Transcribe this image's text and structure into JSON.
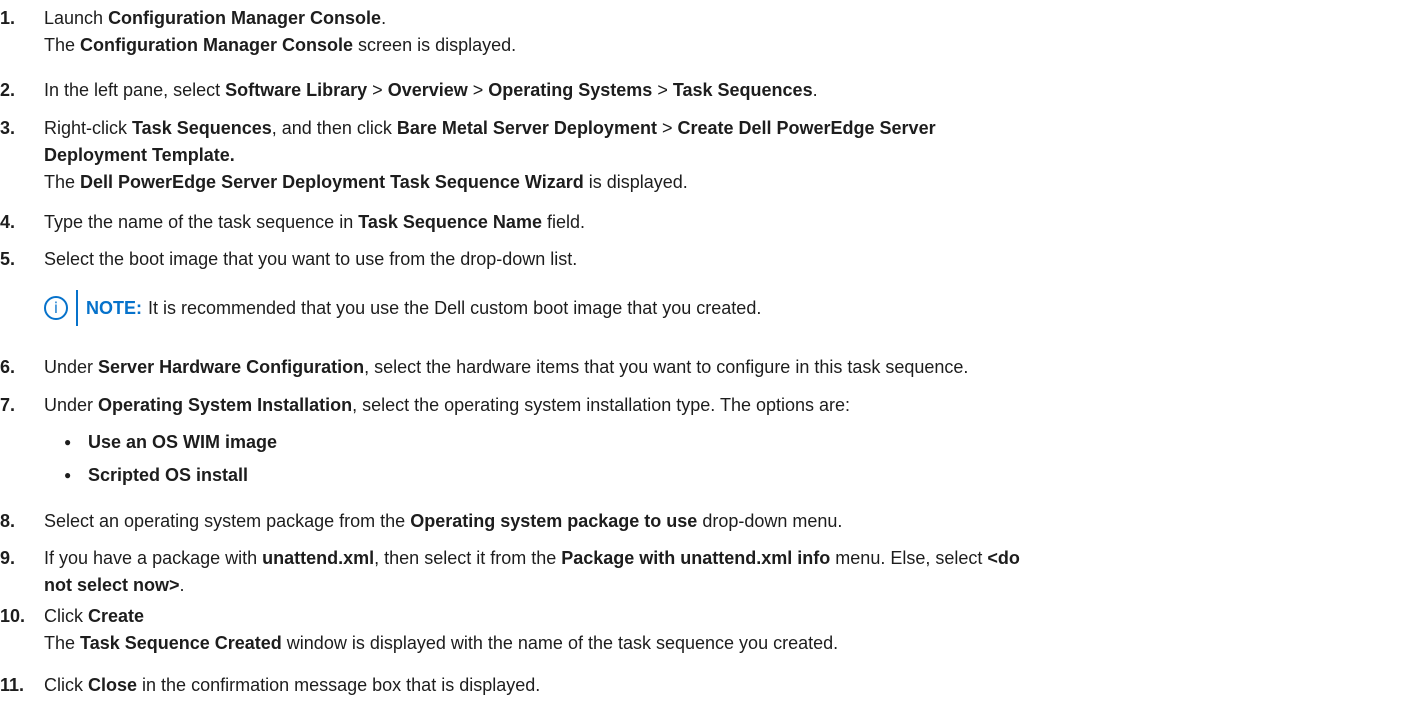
{
  "steps": [
    {
      "num": "1.",
      "parts": [
        [
          "Launch ",
          false
        ],
        [
          "Configuration Manager Console",
          true
        ],
        [
          ".",
          false
        ]
      ],
      "line2": [
        [
          "The ",
          false
        ],
        [
          "Configuration Manager Console",
          true
        ],
        [
          " screen is displayed.",
          false
        ]
      ]
    },
    {
      "num": "2.",
      "parts": [
        [
          "In the left pane, select ",
          false
        ],
        [
          "Software Library",
          true
        ],
        [
          " > ",
          false
        ],
        [
          "Overview",
          true
        ],
        [
          " > ",
          false
        ],
        [
          "Operating Systems",
          true
        ],
        [
          " > ",
          false
        ],
        [
          "Task Sequences",
          true
        ],
        [
          ".",
          false
        ]
      ]
    },
    {
      "num": "3.",
      "parts": [
        [
          "Right-click ",
          false
        ],
        [
          "Task Sequences",
          true
        ],
        [
          ", and then click ",
          false
        ],
        [
          "Bare Metal Server Deployment",
          true
        ],
        [
          " > ",
          false
        ],
        [
          "Create Dell PowerEdge Server",
          true
        ]
      ],
      "line2": [
        [
          "Deployment Template.",
          true
        ]
      ],
      "line3": [
        [
          "The ",
          false
        ],
        [
          "Dell PowerEdge Server Deployment Task Sequence Wizard",
          true
        ],
        [
          " is displayed.",
          false
        ]
      ]
    },
    {
      "num": "4.",
      "parts": [
        [
          "Type the name of the task sequence in ",
          false
        ],
        [
          "Task Sequence Name",
          true
        ],
        [
          " field.",
          false
        ]
      ]
    },
    {
      "num": "5.",
      "parts": [
        [
          "Select the boot image that you want to use from the drop-down list.",
          false
        ]
      ]
    },
    {
      "num": "6.",
      "parts": [
        [
          "Under ",
          false
        ],
        [
          "Server Hardware Configuration",
          true
        ],
        [
          ", select the hardware items that you want to configure in this task sequence.",
          false
        ]
      ]
    },
    {
      "num": "7.",
      "parts": [
        [
          "Under ",
          false
        ],
        [
          "Operating System Installation",
          true
        ],
        [
          ", select the operating system installation type. The options are:",
          false
        ]
      ]
    },
    {
      "num": "8.",
      "parts": [
        [
          "Select an operating system package from the ",
          false
        ],
        [
          "Operating system package to use",
          true
        ],
        [
          " drop-down menu.",
          false
        ]
      ]
    },
    {
      "num": "9.",
      "parts": [
        [
          "If you have a package with ",
          false
        ],
        [
          "unattend.xml",
          true
        ],
        [
          ", then select it from the ",
          false
        ],
        [
          "Package with unattend.xml info",
          true
        ],
        [
          " menu. Else, select ",
          false
        ],
        [
          "<do",
          true
        ]
      ],
      "line2": [
        [
          "not select now>",
          true
        ],
        [
          ".",
          false
        ]
      ]
    },
    {
      "num": "10.",
      "parts": [
        [
          "Click ",
          false
        ],
        [
          "Create",
          true
        ]
      ],
      "line2": [
        [
          "The ",
          false
        ],
        [
          "Task Sequence Created",
          true
        ],
        [
          " window is displayed with the name of the task sequence you created.",
          false
        ]
      ]
    },
    {
      "num": "11.",
      "parts": [
        [
          "Click ",
          false
        ],
        [
          "Close",
          true
        ],
        [
          " in the confirmation message box that is displayed.",
          false
        ]
      ]
    }
  ],
  "note": {
    "icon": "info-icon",
    "label": "NOTE:",
    "text": "It is recommended that you use the Dell custom boot image that you created."
  },
  "bullets": [
    "Use an OS WIM image",
    "Scripted OS install"
  ],
  "colors": {
    "accent": "#0672cb",
    "text": "#1d1d1d"
  }
}
